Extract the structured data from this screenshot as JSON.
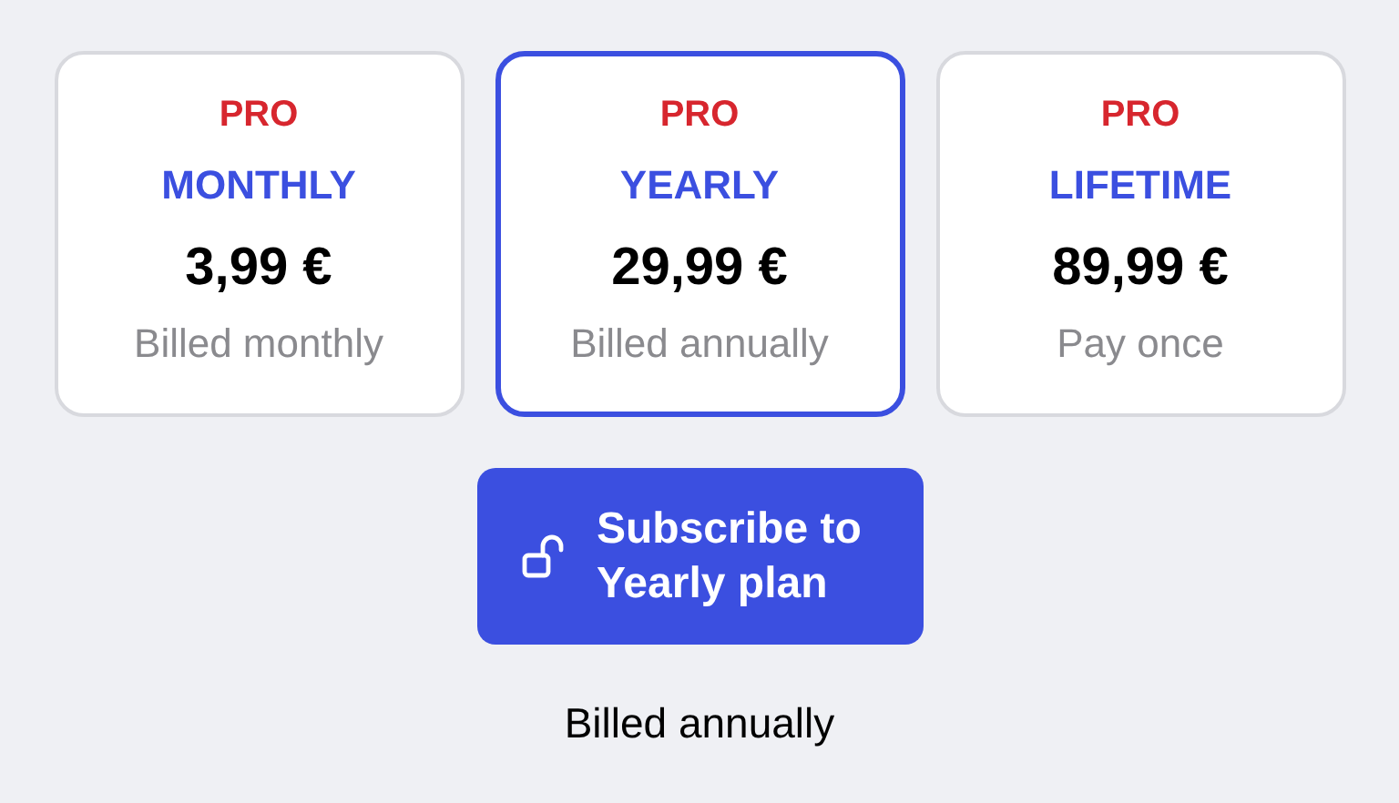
{
  "plans": [
    {
      "badge": "PRO",
      "name": "MONTHLY",
      "price": "3,99 €",
      "billing": "Billed monthly",
      "selected": false
    },
    {
      "badge": "PRO",
      "name": "YEARLY",
      "price": "29,99 €",
      "billing": "Billed annually",
      "selected": true
    },
    {
      "badge": "PRO",
      "name": "LIFETIME",
      "price": "89,99 €",
      "billing": "Pay once",
      "selected": false
    }
  ],
  "subscribe_button": {
    "label": "Subscribe to Yearly plan"
  },
  "footnote": "Billed annually"
}
